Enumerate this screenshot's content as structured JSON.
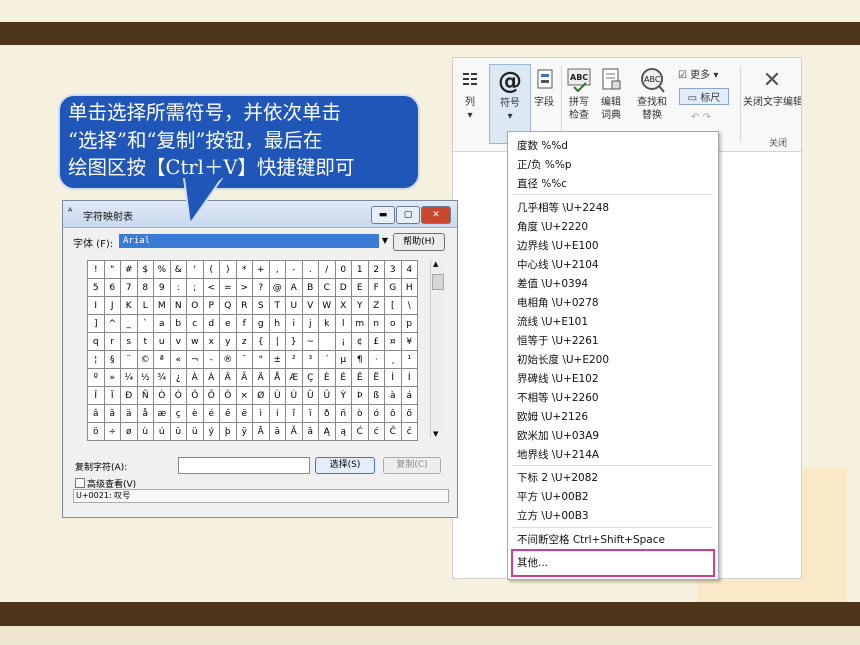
{
  "callout": {
    "lines": [
      "单击选择所需符号，并依次单击",
      "“选择”和“复制”按钮，最后在",
      "绘图区按【Ctrl＋V】快捷键即可"
    ]
  },
  "ribbon": {
    "buttons": [
      {
        "label": "列",
        "icon": "list-icon"
      },
      {
        "label": "符号",
        "icon": "at-symbol-icon"
      },
      {
        "label": "字段",
        "icon": "field-icon"
      },
      {
        "label": "拼写\n检查",
        "icon": "spellcheck-icon"
      },
      {
        "label": "编辑\n词典",
        "icon": "dictionary-icon"
      },
      {
        "label": "查找和\n替换",
        "icon": "find-replace-icon"
      }
    ],
    "more_label": "更多",
    "ruler_label": "标尺",
    "close_editor_label": "关闭文字编辑",
    "close_group_label": "关闭"
  },
  "symbol_menu": {
    "items": [
      "度数  %%d",
      "正/负  %%p",
      "直径  %%c",
      "几乎相等  \\U+2248",
      "角度  \\U+2220",
      "边界线  \\U+E100",
      "中心线  \\U+2104",
      "差值  \\U+0394",
      "电相角  \\U+0278",
      "流线  \\U+E101",
      "恒等于  \\U+2261",
      "初始长度  \\U+E200",
      "界碑线  \\U+E102",
      "不相等  \\U+2260",
      "欧姆  \\U+2126",
      "欧米加  \\U+03A9",
      "地界线  \\U+214A",
      "下标 2  \\U+2082",
      "平方  \\U+00B2",
      "立方  \\U+00B3",
      "不间断空格  Ctrl+Shift+Space",
      "其他..."
    ]
  },
  "charmap": {
    "title": "字符映射表",
    "font_label": "字体 (F):",
    "font_value": "Arial",
    "help_label": "帮助(H)",
    "rows": [
      [
        "!",
        "\"",
        "#",
        "$",
        "%",
        "&",
        "'",
        "(",
        ")",
        "*",
        "+",
        ",",
        "-",
        ".",
        "/",
        "0",
        "1",
        "2",
        "3",
        "4"
      ],
      [
        "5",
        "6",
        "7",
        "8",
        "9",
        ":",
        ";",
        "<",
        "=",
        ">",
        "?",
        "@",
        "A",
        "B",
        "C",
        "D",
        "E",
        "F",
        "G",
        "H"
      ],
      [
        "I",
        "J",
        "K",
        "L",
        "M",
        "N",
        "O",
        "P",
        "Q",
        "R",
        "S",
        "T",
        "U",
        "V",
        "W",
        "X",
        "Y",
        "Z",
        "[",
        "\\"
      ],
      [
        "]",
        "^",
        "_",
        "`",
        "a",
        "b",
        "c",
        "d",
        "e",
        "f",
        "g",
        "h",
        "i",
        "j",
        "k",
        "l",
        "m",
        "n",
        "o",
        "p"
      ],
      [
        "q",
        "r",
        "s",
        "t",
        "u",
        "v",
        "w",
        "x",
        "y",
        "z",
        "{",
        "|",
        "}",
        "~",
        " ",
        "¡",
        "¢",
        "£",
        "¤",
        "¥"
      ],
      [
        "¦",
        "§",
        "¨",
        "©",
        "ª",
        "«",
        "¬",
        "-",
        "®",
        "¯",
        "°",
        "±",
        "²",
        "³",
        "´",
        "µ",
        "¶",
        "·",
        "¸",
        "¹"
      ],
      [
        "º",
        "»",
        "¼",
        "½",
        "¾",
        "¿",
        "À",
        "Á",
        "Â",
        "Ã",
        "Ä",
        "Å",
        "Æ",
        "Ç",
        "È",
        "É",
        "Ê",
        "Ë",
        "Ì",
        "Í"
      ],
      [
        "Î",
        "Ï",
        "Ð",
        "Ñ",
        "Ò",
        "Ó",
        "Ô",
        "Õ",
        "Ö",
        "×",
        "Ø",
        "Ù",
        "Ú",
        "Û",
        "Ü",
        "Ý",
        "Þ",
        "ß",
        "à",
        "á"
      ],
      [
        "â",
        "ã",
        "ä",
        "å",
        "æ",
        "ç",
        "è",
        "é",
        "ê",
        "ë",
        "ì",
        "í",
        "î",
        "ï",
        "ð",
        "ñ",
        "ò",
        "ó",
        "ô",
        "õ"
      ],
      [
        "ö",
        "÷",
        "ø",
        "ù",
        "ú",
        "û",
        "ü",
        "ý",
        "þ",
        "ÿ",
        "Ā",
        "ā",
        "Ă",
        "ă",
        "Ą",
        "ą",
        "Ć",
        "ć",
        "Ĉ",
        "ĉ"
      ]
    ],
    "copy_label": "复制字符(A):",
    "select_label": "选择(S)",
    "copy_button_label": "复制(C)",
    "advanced_label": "高级查看(V)",
    "status": "U+0021: 叹号"
  }
}
